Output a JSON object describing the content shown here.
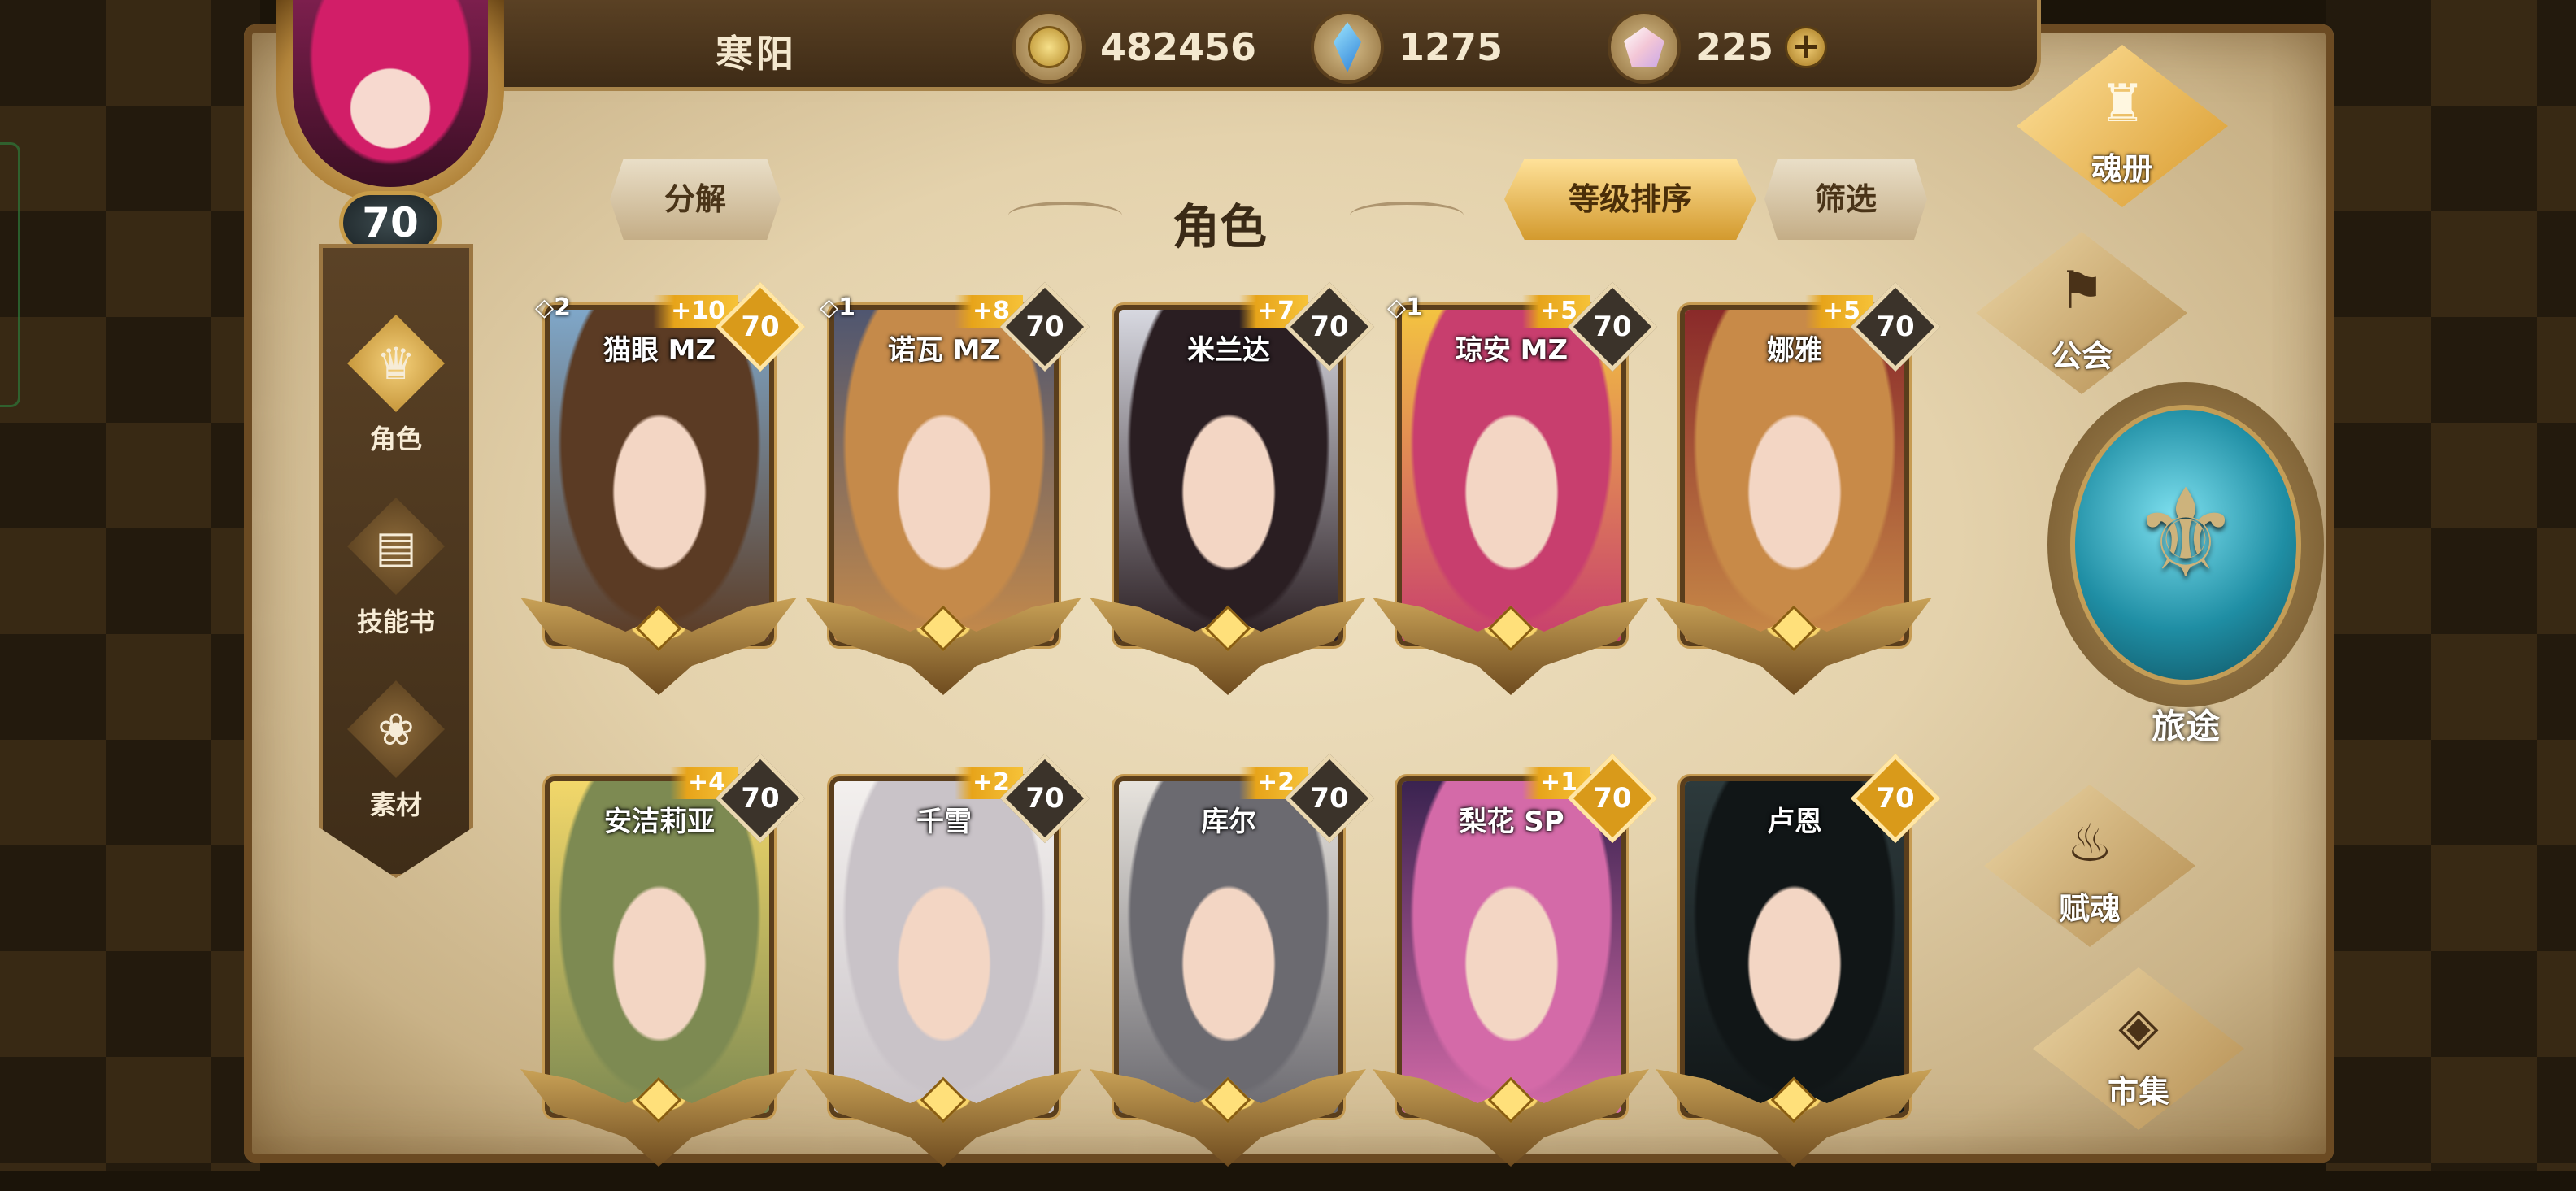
{
  "player": {
    "name": "寒阳",
    "level": "70"
  },
  "currencies": [
    {
      "icon": "gold-coin-icon",
      "value": "482456"
    },
    {
      "icon": "blue-crystal-icon",
      "value": "1275"
    },
    {
      "icon": "pink-gem-icon",
      "value": "225"
    }
  ],
  "header": {
    "title": "角色",
    "decompose": "分解",
    "sort": "等级排序",
    "filter": "筛选",
    "plus": "+"
  },
  "left_nav": [
    {
      "label": "角色",
      "icon": "character-icon",
      "active": true
    },
    {
      "label": "技能书",
      "icon": "skill-book-icon",
      "active": false
    },
    {
      "label": "素材",
      "icon": "materials-icon",
      "active": false
    }
  ],
  "cards": [
    {
      "name": "猫眼 MZ",
      "level": "70",
      "plus": "+10",
      "soul": "◇2",
      "gold": true,
      "colors": [
        "#7fa7c9",
        "#5b3b24"
      ]
    },
    {
      "name": "诺瓦 MZ",
      "level": "70",
      "plus": "+8",
      "soul": "◇1",
      "gold": false,
      "colors": [
        "#4f5670",
        "#c58a4a"
      ]
    },
    {
      "name": "米兰达",
      "level": "70",
      "plus": "+7",
      "soul": "",
      "gold": false,
      "colors": [
        "#d7d8e0",
        "#2a1e22"
      ]
    },
    {
      "name": "琼安 MZ",
      "level": "70",
      "plus": "+5",
      "soul": "◇1",
      "gold": false,
      "colors": [
        "#f3c341",
        "#c83e6e"
      ]
    },
    {
      "name": "娜雅",
      "level": "70",
      "plus": "+5",
      "soul": "",
      "gold": false,
      "colors": [
        "#8a2a2a",
        "#c88a48"
      ]
    },
    {
      "name": "安洁莉亚",
      "level": "70",
      "plus": "+4",
      "soul": "",
      "gold": false,
      "colors": [
        "#f2d76a",
        "#7d8a52"
      ]
    },
    {
      "name": "千雪",
      "level": "70",
      "plus": "+2",
      "soul": "",
      "gold": false,
      "colors": [
        "#f3f0ee",
        "#c9c3c8"
      ]
    },
    {
      "name": "库尔",
      "level": "70",
      "plus": "+2",
      "soul": "",
      "gold": false,
      "colors": [
        "#e7e3dd",
        "#6b6a70"
      ]
    },
    {
      "name": "梨花 SP",
      "level": "70",
      "plus": "+1",
      "soul": "",
      "gold": true,
      "colors": [
        "#3a2350",
        "#d46aa8"
      ]
    },
    {
      "name": "卢恩",
      "level": "70",
      "plus": "",
      "soul": "",
      "gold": true,
      "colors": [
        "#2d3a3c",
        "#111617"
      ]
    }
  ],
  "right_nav": [
    {
      "label": "魂册",
      "icon": "soul-book-icon"
    },
    {
      "label": "公会",
      "icon": "guild-icon"
    },
    {
      "label": "旅途",
      "icon": "journey-icon"
    },
    {
      "label": "赋魂",
      "icon": "soul-infuse-icon"
    },
    {
      "label": "市集",
      "icon": "market-icon"
    }
  ]
}
